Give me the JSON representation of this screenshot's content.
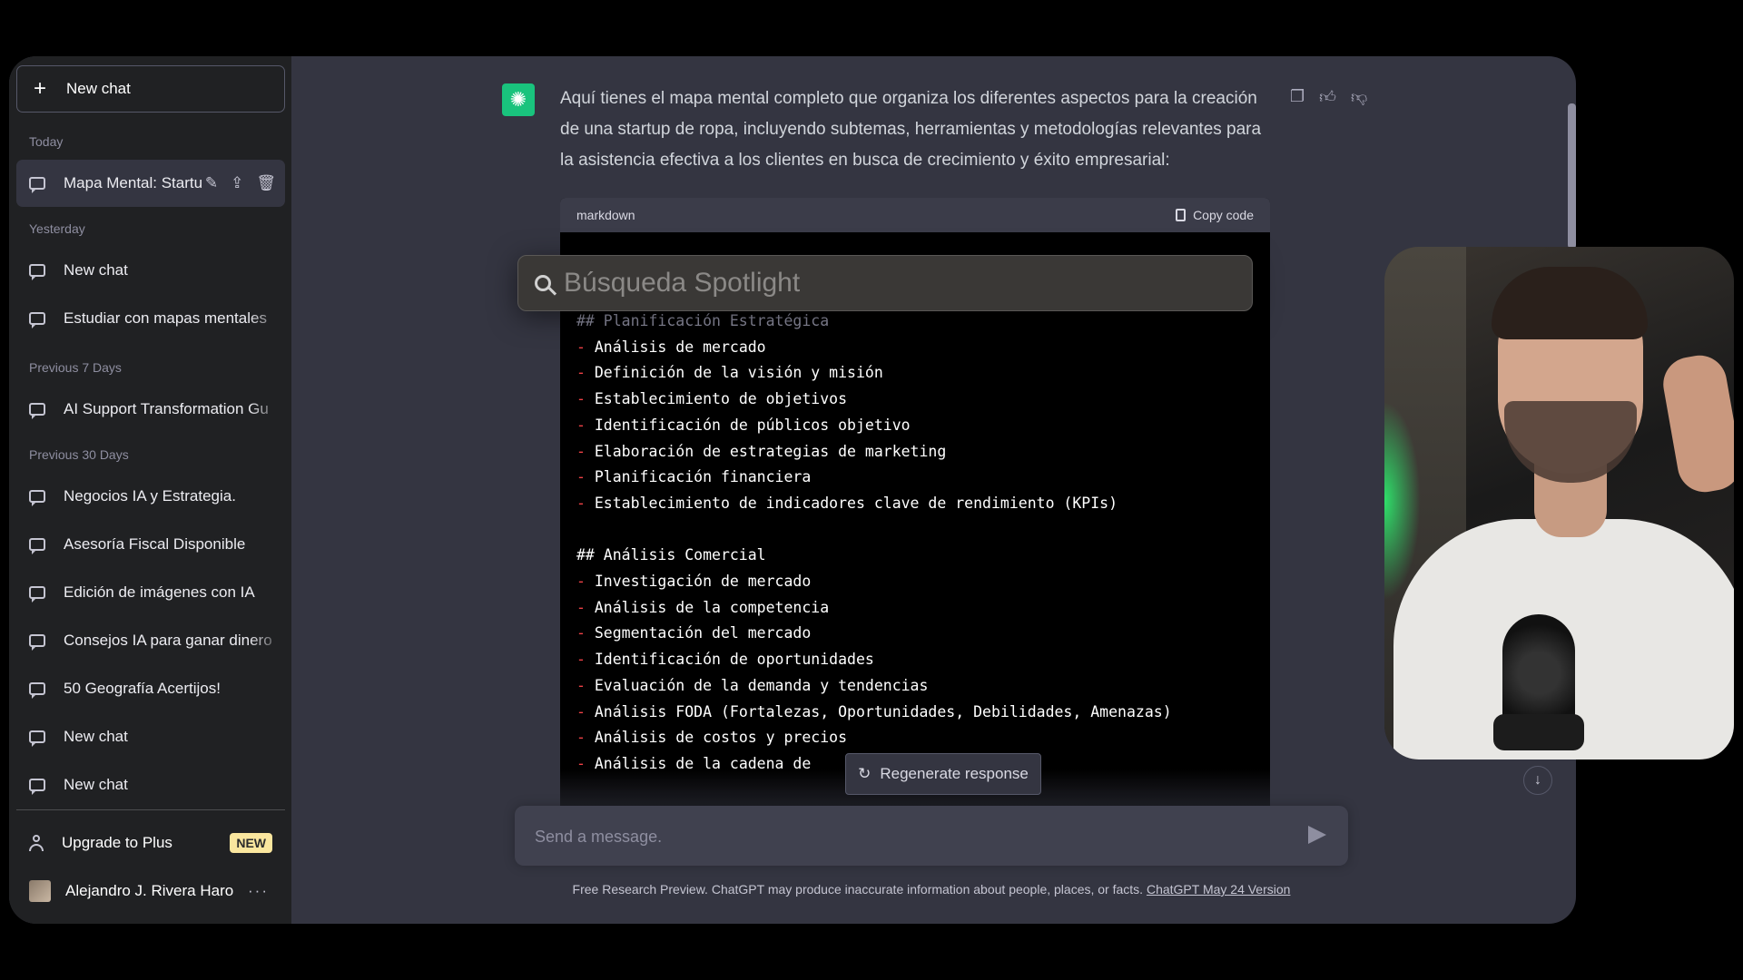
{
  "sidebar": {
    "new_chat_label": "New chat",
    "sections": [
      {
        "label": "Today"
      },
      {
        "label": "Yesterday"
      },
      {
        "label": "Previous 7 Days"
      },
      {
        "label": "Previous 30 Days"
      }
    ],
    "active_item": "Mapa Mental: Startu",
    "yesterday_items": [
      "New chat",
      "Estudiar con mapas mentales"
    ],
    "prev7_items": [
      "AI Support Transformation Gu"
    ],
    "prev30_items": [
      "Negocios IA y Estrategia.",
      "Asesoría Fiscal Disponible",
      "Edición de imágenes con IA",
      "Consejos IA para ganar dinero",
      "50 Geografía Acertijos!",
      "New chat",
      "New chat"
    ],
    "upgrade_label": "Upgrade to Plus",
    "new_badge": "NEW",
    "user_name": "Alejandro J. Rivera Haro",
    "more_glyph": "···"
  },
  "message": {
    "text": "Aquí tienes el mapa mental completo que organiza los diferentes aspectos para la creación de una startup de ropa, incluyendo subtemas, herramientas y metodologías relevantes para la asistencia efectiva a los clientes en busca de crecimiento y éxito empresarial:"
  },
  "code_block": {
    "language": "markdown",
    "copy_label": "Copy code",
    "partial_heading": "## Planificación Estratégica",
    "section1": [
      "Análisis de mercado",
      "Definición de la visión y misión",
      "Establecimiento de objetivos",
      "Identificación de públicos objetivo",
      "Elaboración de estrategias de marketing",
      "Planificación financiera",
      "Establecimiento de indicadores clave de rendimiento (KPIs)"
    ],
    "heading2": "## Análisis Comercial",
    "section2": [
      "Investigación de mercado",
      "Análisis de la competencia",
      "Segmentación del mercado",
      "Identificación de oportunidades",
      "Evaluación de la demanda y tendencias",
      "Análisis FODA (Fortalezas, Oportunidades, Debilidades, Amenazas)",
      "Análisis de costos y precios",
      "Análisis de la cadena de"
    ]
  },
  "regenerate_label": "Regenerate response",
  "input": {
    "placeholder": "Send a message."
  },
  "footer": {
    "note": "Free Research Preview. ChatGPT may produce inaccurate information about people, places, or facts. ",
    "link": "ChatGPT May 24 Version"
  },
  "spotlight": {
    "placeholder": "Búsqueda Spotlight"
  },
  "icons": {
    "copy": "clipboard-icon",
    "like": "thumbs-up-icon",
    "dislike": "thumbs-down-icon",
    "edit": "pencil-icon",
    "share": "share-icon",
    "delete": "trash-icon"
  }
}
